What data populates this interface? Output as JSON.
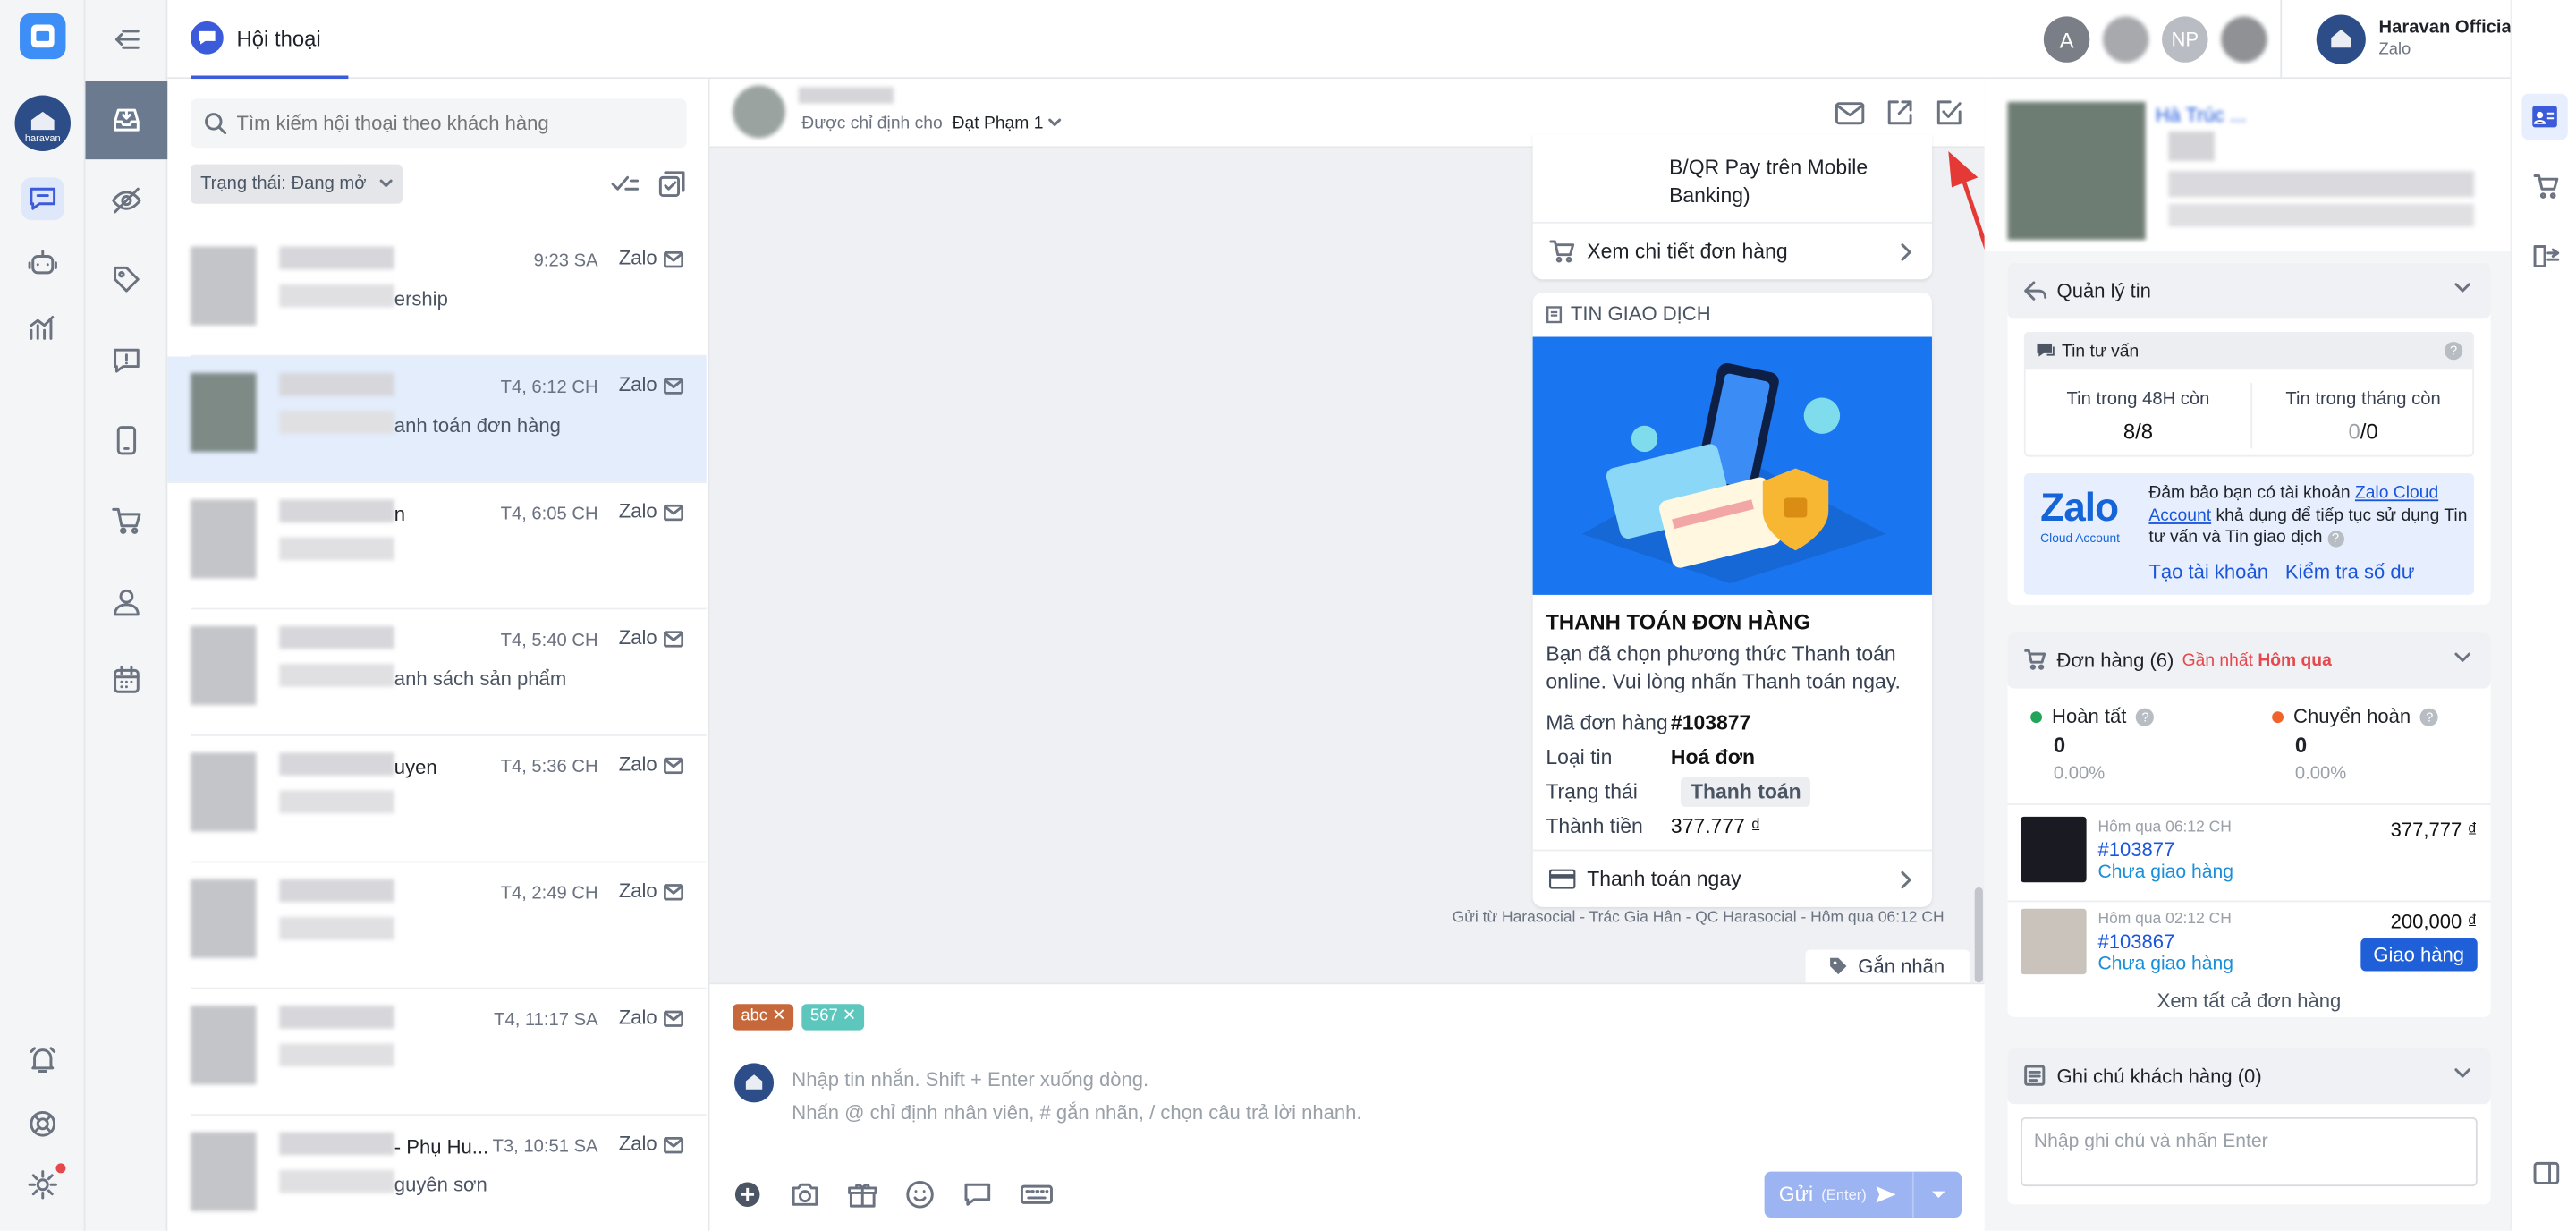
{
  "header": {
    "tab_label": "Hội thoại",
    "account_name": "Haravan Official ...",
    "account_channel": "Zalo",
    "avatars": [
      {
        "initials": "A",
        "color": "#7a7f87"
      },
      {
        "initials": "NP",
        "color": "#b9bcc2"
      }
    ]
  },
  "search": {
    "placeholder": "Tìm kiếm hội thoại theo khách hàng"
  },
  "filter": {
    "label": "Trạng thái: Đang mở"
  },
  "conversations": [
    {
      "time": "9:23 SA",
      "channel": "Zalo",
      "preview": "ership",
      "name": ""
    },
    {
      "time": "T4, 6:12 CH",
      "channel": "Zalo",
      "preview": "anh toán đơn hàng",
      "name": ""
    },
    {
      "time": "T4, 6:05 CH",
      "channel": "Zalo",
      "preview": "",
      "name": "n"
    },
    {
      "time": "T4, 5:40 CH",
      "channel": "Zalo",
      "preview": "anh sách sản phẩm",
      "name": ""
    },
    {
      "time": "T4, 5:36 CH",
      "channel": "Zalo",
      "preview": "",
      "name": "uyen"
    },
    {
      "time": "T4, 2:49 CH",
      "channel": "Zalo",
      "preview": "",
      "name": ""
    },
    {
      "time": "T4, 11:17 SA",
      "channel": "Zalo",
      "preview": "",
      "name": ""
    },
    {
      "time": "T3, 10:51 SA",
      "channel": "Zalo",
      "preview": "guyên sơn",
      "name": "- Phụ Hu..."
    }
  ],
  "chat_header": {
    "assigned_prefix": "Được chỉ định cho",
    "assignee": "Đạt Phạm 1"
  },
  "message1": {
    "text_line1": "B/QR Pay trên Mobile",
    "text_line2": "Banking)",
    "action": "Xem chi tiết đơn hàng"
  },
  "message2": {
    "header": "TIN GIAO DỊCH",
    "title": "THANH TOÁN ĐƠN HÀNG",
    "desc_line1": "Bạn đã chọn phương thức Thanh toán",
    "desc_line2": "online. Vui lòng nhấn Thanh toán ngay.",
    "fields": [
      {
        "label": "Mã đơn hàng",
        "value": "#103877"
      },
      {
        "label": "Loại tin",
        "value": "Hoá đơn"
      },
      {
        "label": "Trạng thái",
        "value": "Thanh toán"
      },
      {
        "label": "Thành tiền",
        "value": "377.777 ₫"
      }
    ],
    "action": "Thanh toán ngay",
    "sent_by": "Gửi từ Harasocial - Trác Gia Hân - QC Harasocial - Hôm qua 06:12 CH"
  },
  "label_button": "Gắn nhãn",
  "tags": [
    {
      "text": "abc",
      "color": "#c7683a"
    },
    {
      "text": "567",
      "color": "#5dc7be"
    }
  ],
  "composer": {
    "line1": "Nhập tin nhắn. Shift + Enter xuống dòng.",
    "line2": "Nhấn @ chỉ định nhân viên, # gắn nhãn, / chọn câu trả lời nhanh.",
    "send_label": "Gửi",
    "send_hint": "(Enter)"
  },
  "right_panel": {
    "profile_name": "Hà Trúc ...",
    "messages_section": {
      "title": "Quản lý tin",
      "sub_title": "Tin tư vấn",
      "col1_label": "Tin trong 48H còn",
      "col1_value": "8/8",
      "col2_label": "Tin trong tháng còn",
      "col2_value_used": "0",
      "col2_value_total": "/0",
      "zalo_logo": "Zalo",
      "zalo_logo_sub": "Cloud Account",
      "notice_prefix": "Đảm bảo bạn có tài khoản ",
      "notice_link": "Zalo Cloud Account",
      "notice_suffix": " khả dụng để tiếp tục sử dụng Tin tư vấn và Tin giao dịch",
      "create_link": "Tạo tài khoản",
      "check_link": "Kiểm tra số dư"
    },
    "orders_section": {
      "title": "Đơn hàng (6)",
      "latest_prefix": "Gần nhất",
      "latest_value": "Hôm qua",
      "done_label": "Hoàn tất",
      "done_count": "0",
      "done_pct": "0.00%",
      "return_label": "Chuyển hoàn",
      "return_count": "0",
      "return_pct": "0.00%",
      "orders": [
        {
          "time": "Hôm qua 06:12 CH",
          "code": "#103877",
          "status": "Chưa giao hàng",
          "amount": "377,777 ₫",
          "button": ""
        },
        {
          "time": "Hôm qua 02:12 CH",
          "code": "#103867",
          "status": "Chưa giao hàng",
          "amount": "200,000 ₫",
          "button": "Giao hàng"
        }
      ],
      "view_all": "Xem tất cả đơn hàng"
    },
    "notes_section": {
      "title": "Ghi chú khách hàng (0)",
      "placeholder": "Nhập ghi chú và nhấn Enter"
    }
  },
  "colors": {
    "primary": "#3b5bdb",
    "rail_bg": "#f4f5f7",
    "selected_row": "#e3edfc",
    "promo": "#1a75f0"
  }
}
